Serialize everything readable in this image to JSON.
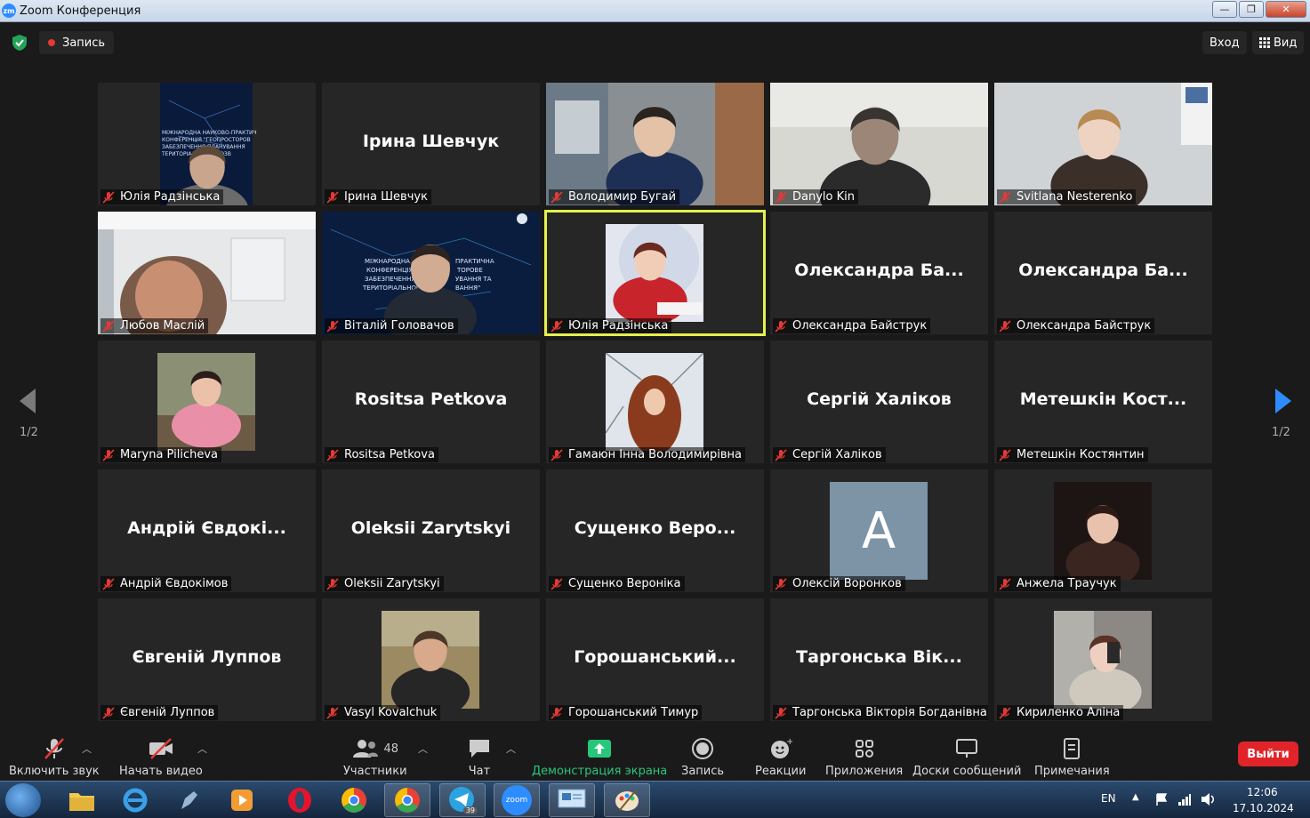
{
  "window": {
    "title": "Zoom Конференция",
    "app_icon": "zm"
  },
  "topbar": {
    "record_label": "Запись",
    "enter_label": "Вход",
    "view_label": "Вид"
  },
  "tiles": [
    {
      "display": "",
      "label": "Юлія Радзінська",
      "kind": "video"
    },
    {
      "display": "Ірина Шевчук",
      "label": "Ірина Шевчук",
      "kind": "name"
    },
    {
      "display": "",
      "label": "Володимир Бугай",
      "kind": "video"
    },
    {
      "display": "",
      "label": "Danylo Kin",
      "kind": "video"
    },
    {
      "display": "",
      "label": "Svitlana Nesterenko",
      "kind": "video"
    },
    {
      "display": "",
      "label": "Любов Маслій",
      "kind": "video"
    },
    {
      "display": "",
      "label": "Віталій Головачов",
      "kind": "video"
    },
    {
      "display": "",
      "label": "Юлія Радзінська",
      "kind": "photo"
    },
    {
      "display": "Олександра Ба...",
      "label": "Олександра Байструк",
      "kind": "name"
    },
    {
      "display": "Олександра Ба...",
      "label": "Олександра Байструк",
      "kind": "name"
    },
    {
      "display": "",
      "label": "Maryna Pilicheva",
      "kind": "photo"
    },
    {
      "display": "Rositsa Petkova",
      "label": "Rositsa Petkova",
      "kind": "name"
    },
    {
      "display": "",
      "label": "Гамаюн Інна Володимирівна",
      "kind": "photo"
    },
    {
      "display": "Сергій Халіков",
      "label": "Сергій Халіков",
      "kind": "name"
    },
    {
      "display": "Метешкін Кост...",
      "label": "Метешкін Костянтин",
      "kind": "name"
    },
    {
      "display": "Андрій Євдокі...",
      "label": "Андрій Євдокімов",
      "kind": "name"
    },
    {
      "display": "Oleksii Zarytskyi",
      "label": "Oleksii Zarytskyi",
      "kind": "name"
    },
    {
      "display": "Сущенко Веро...",
      "label": "Сущенко Вероніка",
      "kind": "name"
    },
    {
      "display": "A",
      "label": "Олексій Воронков",
      "kind": "avatar"
    },
    {
      "display": "",
      "label": "Анжела Траучук",
      "kind": "photo"
    },
    {
      "display": "Євгеній Луппов",
      "label": "Євгеній Луппов",
      "kind": "name"
    },
    {
      "display": "",
      "label": "Vasyl Kovalchuk",
      "kind": "photo"
    },
    {
      "display": "Горошанський...",
      "label": "Горошанський Тимур",
      "kind": "name"
    },
    {
      "display": "Таргонська Вік...",
      "label": "Таргонська Вікторія Богданівна",
      "kind": "name"
    },
    {
      "display": "",
      "label": "Кириленко Аліна",
      "kind": "photo"
    }
  ],
  "pagination": {
    "left": "1/2",
    "right": "1/2"
  },
  "toolbar": {
    "unmute": "Включить звук",
    "start_video": "Начать видео",
    "participants": "Участники",
    "participants_count": "48",
    "chat": "Чат",
    "share": "Демонстрация экрана",
    "record": "Запись",
    "reactions": "Реакции",
    "apps": "Приложения",
    "whiteboards": "Доски сообщений",
    "notes": "Примечания",
    "leave": "Выйти"
  },
  "taskbar": {
    "lang": "EN",
    "time": "12:06",
    "date": "17.10.2024",
    "telegram_badge": "39",
    "zoom_app": "zoom"
  },
  "colors": {
    "active_speaker": "#e6f04b",
    "leave": "#e0242a",
    "share_green": "#27c77b",
    "muted_red": "#e53935"
  }
}
